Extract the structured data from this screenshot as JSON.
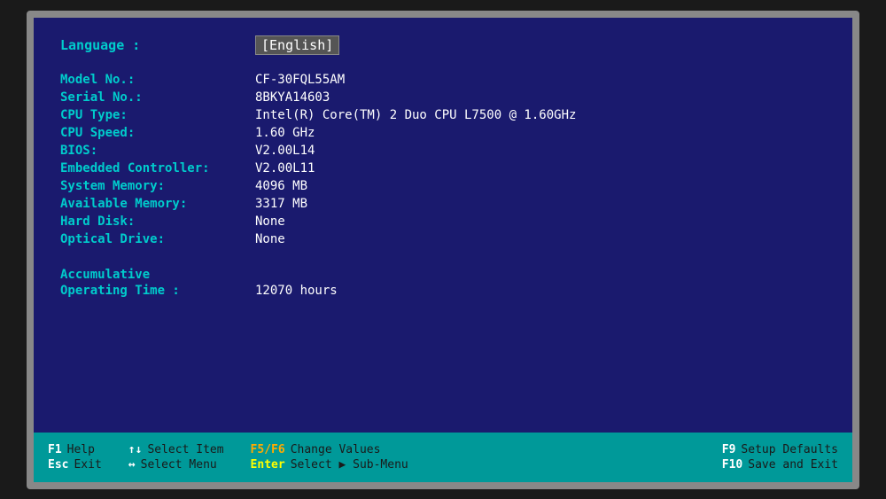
{
  "bios": {
    "language_label": "Language :",
    "language_value": "[English]",
    "fields": [
      {
        "label": "Model No.:",
        "value": "CF-30FQL55AM"
      },
      {
        "label": "Serial No.:",
        "value": "8BKYA14603"
      },
      {
        "label": "CPU Type:",
        "value": "Intel(R) Core(TM) 2 Duo CPU L7500 @ 1.60GHz"
      },
      {
        "label": "CPU Speed:",
        "value": "1.60  GHz"
      },
      {
        "label": "BIOS:",
        "value": "V2.00L14"
      },
      {
        "label": "Embedded Controller:",
        "value": "V2.00L11"
      },
      {
        "label": "System Memory:",
        "value": "4096 MB"
      },
      {
        "label": "Available Memory:",
        "value": "3317 MB"
      },
      {
        "label": "Hard Disk:",
        "value": "None"
      },
      {
        "label": "Optical Drive:",
        "value": "None"
      }
    ],
    "accumulative_title": "Accumulative",
    "operating_time_label": "Operating Time :",
    "operating_time_value": "12070  hours"
  },
  "bottom_bar": {
    "items": [
      {
        "key": "F1",
        "desc": "Help",
        "key2": "Esc",
        "desc2": "Exit"
      },
      {
        "key": "↑↓",
        "desc": "Select Item",
        "key2": "↔",
        "desc2": "Select Menu"
      },
      {
        "key": "F5/F6",
        "desc": "Change Values",
        "key2": "Enter",
        "desc2": "Select ▶ Sub-Menu"
      },
      {
        "key": "F9",
        "desc": "Setup Defaults",
        "key2": "F10",
        "desc2": "Save and Exit"
      }
    ]
  }
}
